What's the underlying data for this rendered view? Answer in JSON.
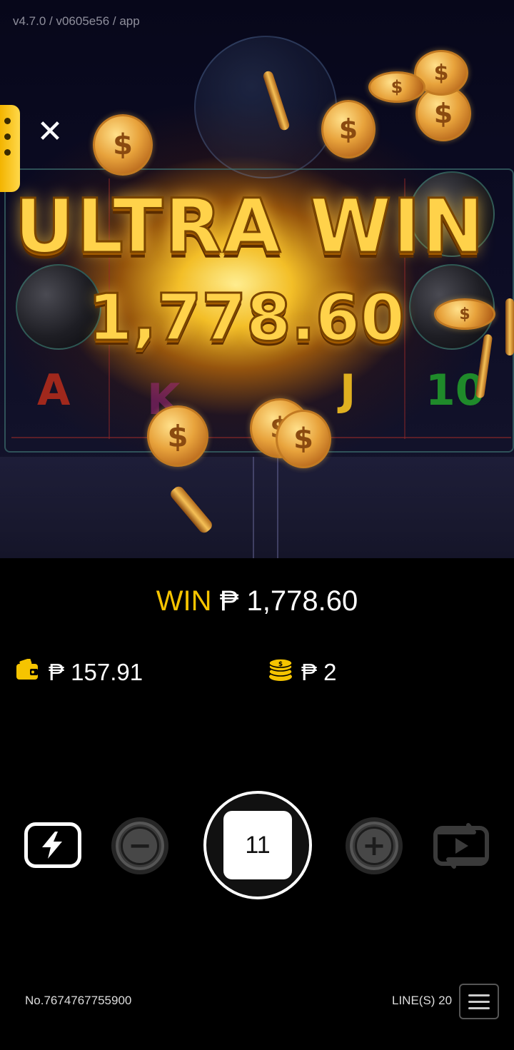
{
  "version_label": "v4.7.0 / v0605e56 / app",
  "celebration": {
    "title": "ULTRA WIN",
    "amount": "1,778.60"
  },
  "reels": {
    "visible_symbols": [
      "A",
      "K",
      "J",
      "10"
    ]
  },
  "info": {
    "win_label": "WIN",
    "win_value": "₱ 1,778.60",
    "balance_value": "₱ 157.91",
    "bet_value": "₱ 2"
  },
  "controls": {
    "spin_count": "11",
    "minus_symbol": "−",
    "plus_symbol": "+"
  },
  "footer": {
    "round_number": "No.7674767755900",
    "lines_label": "LINE(S) 20"
  },
  "colors": {
    "accent_gold": "#f5c400",
    "background": "#000000"
  },
  "icons": [
    "close-icon",
    "wallet-icon",
    "coin-stack-icon",
    "turbo-icon",
    "minus-icon",
    "plus-icon",
    "autoplay-icon",
    "hamburger-menu-icon"
  ]
}
